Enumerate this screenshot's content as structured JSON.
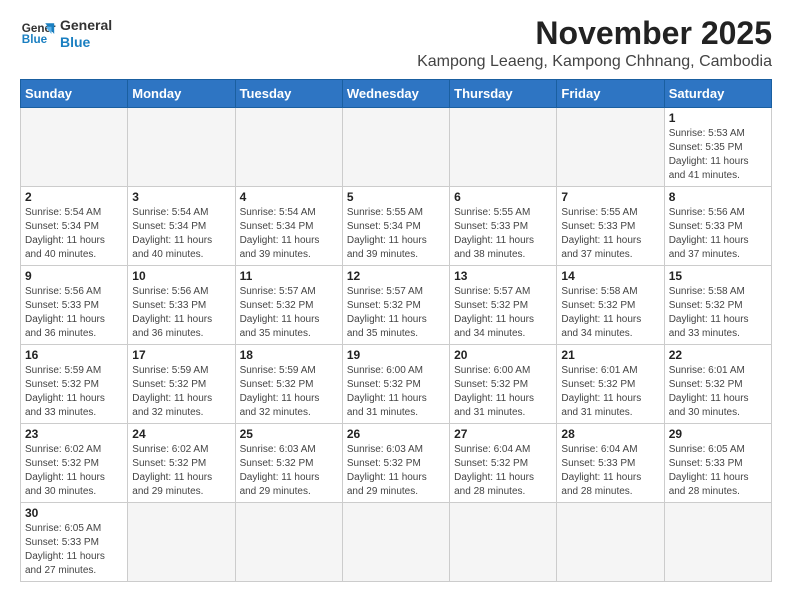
{
  "logo": {
    "line1": "General",
    "line2": "Blue"
  },
  "title": "November 2025",
  "subtitle": "Kampong Leaeng, Kampong Chhnang, Cambodia",
  "days_of_week": [
    "Sunday",
    "Monday",
    "Tuesday",
    "Wednesday",
    "Thursday",
    "Friday",
    "Saturday"
  ],
  "weeks": [
    [
      {
        "day": "",
        "info": ""
      },
      {
        "day": "",
        "info": ""
      },
      {
        "day": "",
        "info": ""
      },
      {
        "day": "",
        "info": ""
      },
      {
        "day": "",
        "info": ""
      },
      {
        "day": "",
        "info": ""
      },
      {
        "day": "1",
        "info": "Sunrise: 5:53 AM\nSunset: 5:35 PM\nDaylight: 11 hours and 41 minutes."
      }
    ],
    [
      {
        "day": "2",
        "info": "Sunrise: 5:54 AM\nSunset: 5:34 PM\nDaylight: 11 hours and 40 minutes."
      },
      {
        "day": "3",
        "info": "Sunrise: 5:54 AM\nSunset: 5:34 PM\nDaylight: 11 hours and 40 minutes."
      },
      {
        "day": "4",
        "info": "Sunrise: 5:54 AM\nSunset: 5:34 PM\nDaylight: 11 hours and 39 minutes."
      },
      {
        "day": "5",
        "info": "Sunrise: 5:55 AM\nSunset: 5:34 PM\nDaylight: 11 hours and 39 minutes."
      },
      {
        "day": "6",
        "info": "Sunrise: 5:55 AM\nSunset: 5:33 PM\nDaylight: 11 hours and 38 minutes."
      },
      {
        "day": "7",
        "info": "Sunrise: 5:55 AM\nSunset: 5:33 PM\nDaylight: 11 hours and 37 minutes."
      },
      {
        "day": "8",
        "info": "Sunrise: 5:56 AM\nSunset: 5:33 PM\nDaylight: 11 hours and 37 minutes."
      }
    ],
    [
      {
        "day": "9",
        "info": "Sunrise: 5:56 AM\nSunset: 5:33 PM\nDaylight: 11 hours and 36 minutes."
      },
      {
        "day": "10",
        "info": "Sunrise: 5:56 AM\nSunset: 5:33 PM\nDaylight: 11 hours and 36 minutes."
      },
      {
        "day": "11",
        "info": "Sunrise: 5:57 AM\nSunset: 5:32 PM\nDaylight: 11 hours and 35 minutes."
      },
      {
        "day": "12",
        "info": "Sunrise: 5:57 AM\nSunset: 5:32 PM\nDaylight: 11 hours and 35 minutes."
      },
      {
        "day": "13",
        "info": "Sunrise: 5:57 AM\nSunset: 5:32 PM\nDaylight: 11 hours and 34 minutes."
      },
      {
        "day": "14",
        "info": "Sunrise: 5:58 AM\nSunset: 5:32 PM\nDaylight: 11 hours and 34 minutes."
      },
      {
        "day": "15",
        "info": "Sunrise: 5:58 AM\nSunset: 5:32 PM\nDaylight: 11 hours and 33 minutes."
      }
    ],
    [
      {
        "day": "16",
        "info": "Sunrise: 5:59 AM\nSunset: 5:32 PM\nDaylight: 11 hours and 33 minutes."
      },
      {
        "day": "17",
        "info": "Sunrise: 5:59 AM\nSunset: 5:32 PM\nDaylight: 11 hours and 32 minutes."
      },
      {
        "day": "18",
        "info": "Sunrise: 5:59 AM\nSunset: 5:32 PM\nDaylight: 11 hours and 32 minutes."
      },
      {
        "day": "19",
        "info": "Sunrise: 6:00 AM\nSunset: 5:32 PM\nDaylight: 11 hours and 31 minutes."
      },
      {
        "day": "20",
        "info": "Sunrise: 6:00 AM\nSunset: 5:32 PM\nDaylight: 11 hours and 31 minutes."
      },
      {
        "day": "21",
        "info": "Sunrise: 6:01 AM\nSunset: 5:32 PM\nDaylight: 11 hours and 31 minutes."
      },
      {
        "day": "22",
        "info": "Sunrise: 6:01 AM\nSunset: 5:32 PM\nDaylight: 11 hours and 30 minutes."
      }
    ],
    [
      {
        "day": "23",
        "info": "Sunrise: 6:02 AM\nSunset: 5:32 PM\nDaylight: 11 hours and 30 minutes."
      },
      {
        "day": "24",
        "info": "Sunrise: 6:02 AM\nSunset: 5:32 PM\nDaylight: 11 hours and 29 minutes."
      },
      {
        "day": "25",
        "info": "Sunrise: 6:03 AM\nSunset: 5:32 PM\nDaylight: 11 hours and 29 minutes."
      },
      {
        "day": "26",
        "info": "Sunrise: 6:03 AM\nSunset: 5:32 PM\nDaylight: 11 hours and 29 minutes."
      },
      {
        "day": "27",
        "info": "Sunrise: 6:04 AM\nSunset: 5:32 PM\nDaylight: 11 hours and 28 minutes."
      },
      {
        "day": "28",
        "info": "Sunrise: 6:04 AM\nSunset: 5:33 PM\nDaylight: 11 hours and 28 minutes."
      },
      {
        "day": "29",
        "info": "Sunrise: 6:05 AM\nSunset: 5:33 PM\nDaylight: 11 hours and 28 minutes."
      }
    ],
    [
      {
        "day": "30",
        "info": "Sunrise: 6:05 AM\nSunset: 5:33 PM\nDaylight: 11 hours and 27 minutes."
      },
      {
        "day": "",
        "info": ""
      },
      {
        "day": "",
        "info": ""
      },
      {
        "day": "",
        "info": ""
      },
      {
        "day": "",
        "info": ""
      },
      {
        "day": "",
        "info": ""
      },
      {
        "day": "",
        "info": ""
      }
    ]
  ]
}
